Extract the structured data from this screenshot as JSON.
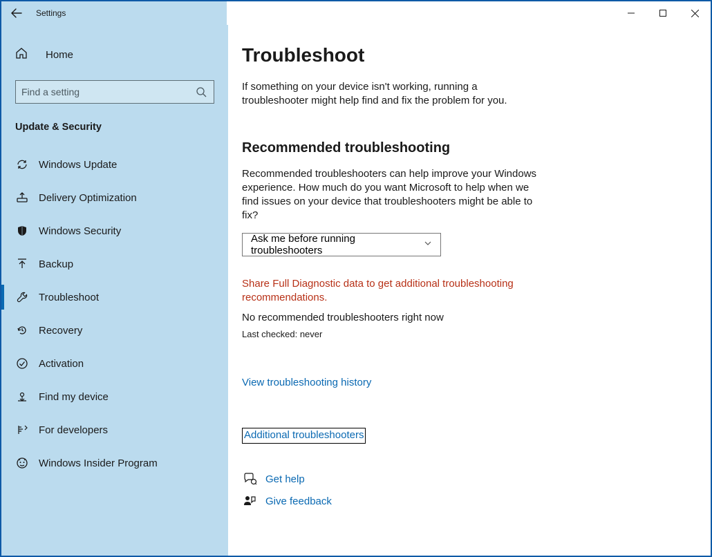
{
  "window": {
    "app_title": "Settings"
  },
  "sidebar": {
    "home_label": "Home",
    "search_placeholder": "Find a setting",
    "section_label": "Update & Security",
    "items": [
      {
        "id": "windows-update",
        "label": "Windows Update",
        "icon": "sync-icon",
        "selected": false
      },
      {
        "id": "delivery-optimization",
        "label": "Delivery Optimization",
        "icon": "delivery-icon",
        "selected": false
      },
      {
        "id": "windows-security",
        "label": "Windows Security",
        "icon": "shield-icon",
        "selected": false
      },
      {
        "id": "backup",
        "label": "Backup",
        "icon": "backup-icon",
        "selected": false
      },
      {
        "id": "troubleshoot",
        "label": "Troubleshoot",
        "icon": "wrench-icon",
        "selected": true
      },
      {
        "id": "recovery",
        "label": "Recovery",
        "icon": "recovery-icon",
        "selected": false
      },
      {
        "id": "activation",
        "label": "Activation",
        "icon": "check-circle-icon",
        "selected": false
      },
      {
        "id": "find-my-device",
        "label": "Find my device",
        "icon": "location-icon",
        "selected": false
      },
      {
        "id": "for-developers",
        "label": "For developers",
        "icon": "dev-icon",
        "selected": false
      },
      {
        "id": "windows-insider-program",
        "label": "Windows Insider Program",
        "icon": "insider-icon",
        "selected": false
      }
    ]
  },
  "main": {
    "title": "Troubleshoot",
    "intro": "If something on your device isn't working, running a troubleshooter might help find and fix the problem for you.",
    "recommended": {
      "heading": "Recommended troubleshooting",
      "description": "Recommended troubleshooters can help improve your Windows experience. How much do you want Microsoft to help when we find issues on your device that troubleshooters might be able to fix?",
      "dropdown_value": "Ask me before running troubleshooters",
      "warning": "Share Full Diagnostic data to get additional troubleshooting recommendations.",
      "no_recommended": "No recommended troubleshooters right now",
      "last_checked": "Last checked: never"
    },
    "links": {
      "history": "View troubleshooting history",
      "additional": "Additional troubleshooters",
      "get_help": "Get help",
      "give_feedback": "Give feedback"
    }
  }
}
